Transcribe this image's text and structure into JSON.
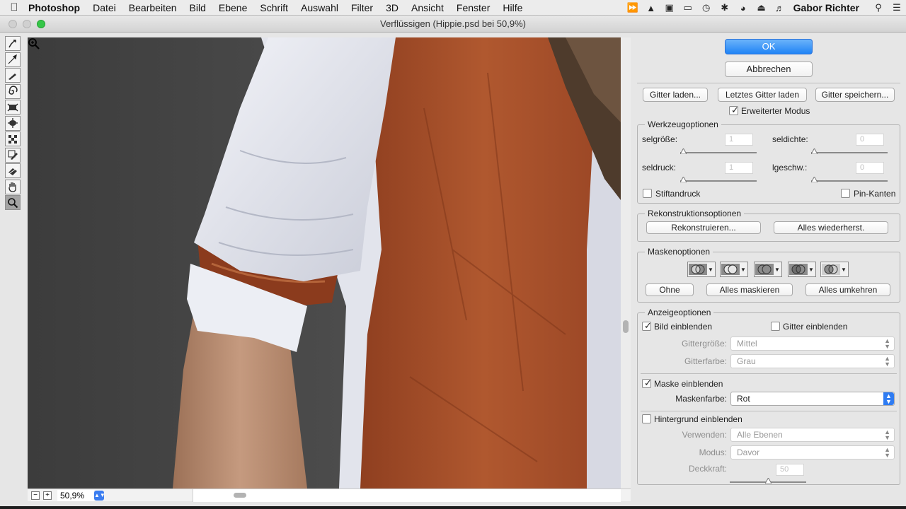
{
  "menubar": {
    "app": "Photoshop",
    "items": [
      "Datei",
      "Bearbeiten",
      "Bild",
      "Ebene",
      "Schrift",
      "Auswahl",
      "Filter",
      "3D",
      "Ansicht",
      "Fenster",
      "Hilfe"
    ],
    "user": "Gabor Richter"
  },
  "window": {
    "title": "Verflüssigen (Hippie.psd bei 50,9%)"
  },
  "canvas": {
    "zoom": "50,9%"
  },
  "buttons": {
    "ok": "OK",
    "cancel": "Abbrechen",
    "load_mesh": "Gitter laden...",
    "load_last_mesh": "Letztes Gitter laden",
    "save_mesh": "Gitter speichern..."
  },
  "advanced_mode": {
    "label": "Erweiterter Modus",
    "checked": true
  },
  "tool_options": {
    "title": "Werkzeugoptionen",
    "brush_size": {
      "label": "selgröße:",
      "value": "1"
    },
    "brush_density": {
      "label": "seldichte:",
      "value": "0"
    },
    "brush_pressure": {
      "label": "seldruck:",
      "value": "1"
    },
    "brush_rate": {
      "label": "lgeschw.:",
      "value": "0"
    },
    "stylus_pressure": "Stiftandruck",
    "pin_edges": "Pin-Kanten"
  },
  "reconstruct_options": {
    "title": "Rekonstruktionsoptionen",
    "reconstruct": "Rekonstruieren...",
    "restore_all": "Alles wiederherst."
  },
  "mask_options": {
    "title": "Maskenoptionen",
    "none": "Ohne",
    "mask_all": "Alles maskieren",
    "invert_all": "Alles umkehren"
  },
  "view_options": {
    "title": "Anzeigeoptionen",
    "show_image": "Bild einblenden",
    "show_mesh": "Gitter einblenden",
    "mesh_size": {
      "label": "Gittergröße:",
      "value": "Mittel"
    },
    "mesh_color": {
      "label": "Gitterfarbe:",
      "value": "Grau"
    },
    "show_mask": "Maske einblenden",
    "mask_color": {
      "label": "Maskenfarbe:",
      "value": "Rot"
    },
    "show_backdrop": "Hintergrund einblenden",
    "use": {
      "label": "Verwenden:",
      "value": "Alle Ebenen"
    },
    "mode": {
      "label": "Modus:",
      "value": "Davor"
    },
    "opacity": {
      "label": "Deckkraft:",
      "value": "50"
    }
  },
  "colors": {
    "accent": "#2f7cf2",
    "shirt": "#e9ecf3",
    "vest": "#a84f2c",
    "backdrop": "#4a4a4a"
  }
}
